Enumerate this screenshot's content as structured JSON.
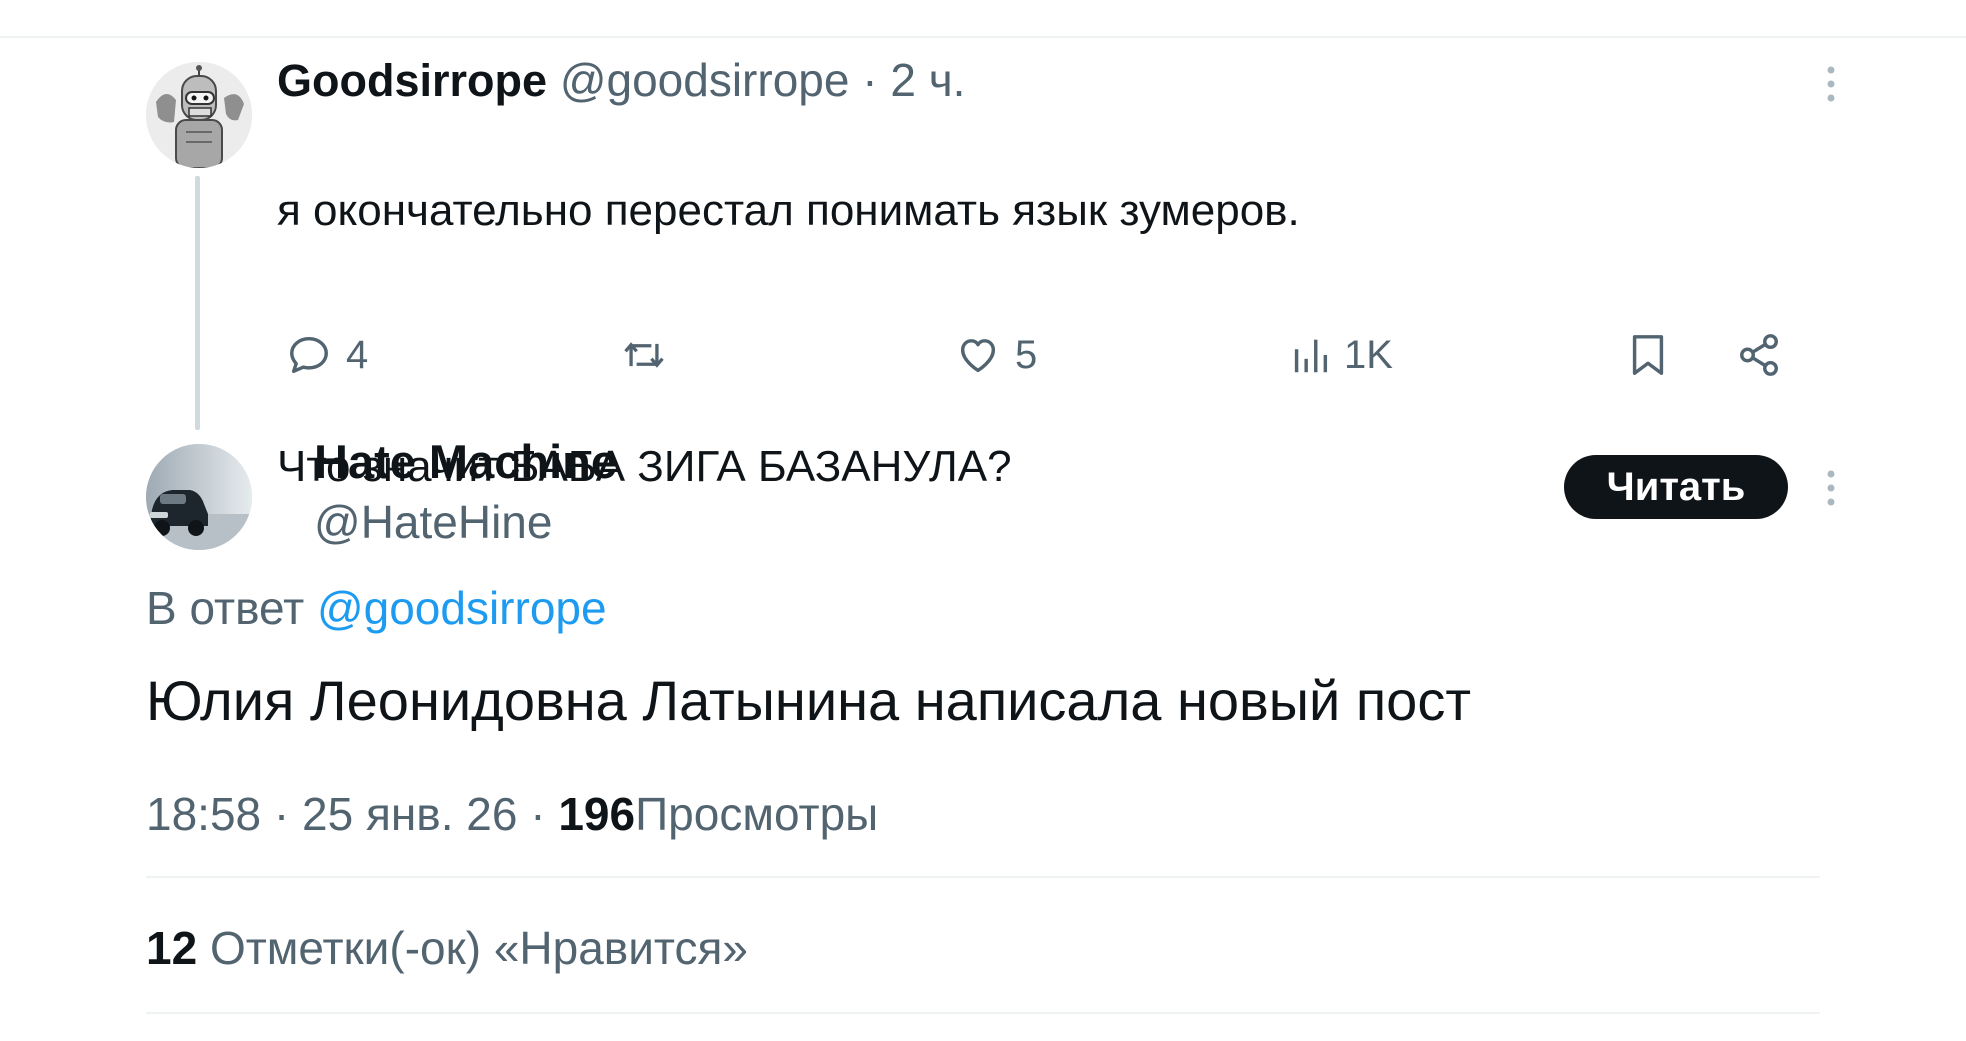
{
  "parent_tweet": {
    "author_name": "Goodsirrope",
    "handle": "@goodsirrope",
    "separator": "·",
    "time": "2 ч.",
    "text_line1": "я окончательно перестал понимать язык зумеров.",
    "text_line2": "Что значит БАБА ЗИГА БАЗАНУЛА?",
    "actions": {
      "replies": "4",
      "likes": "5",
      "views": "1K"
    },
    "avatar_icon": "robot-avatar-icon"
  },
  "main_tweet": {
    "author_name": "Hate Machine",
    "handle": "@HateHine",
    "follow_label": "Читать",
    "reply_prefix": "В ответ",
    "reply_to_handle": "@goodsirrope",
    "text": "Юлия Леонидовна Латынина написала новый пост",
    "time": "18:58",
    "separator": "·",
    "date": "25 янв. 26",
    "views_count": "196",
    "views_label": "Просмотры",
    "likes_count": "12",
    "likes_label": "Отметки(-ок) «Нравится»",
    "avatar_icon": "car-photo-avatar-icon"
  },
  "colors": {
    "text_primary": "#0f1419",
    "text_secondary": "#536471",
    "link": "#1d9bf0",
    "divider": "#eff3f4",
    "thread_line": "#cfd9de"
  }
}
